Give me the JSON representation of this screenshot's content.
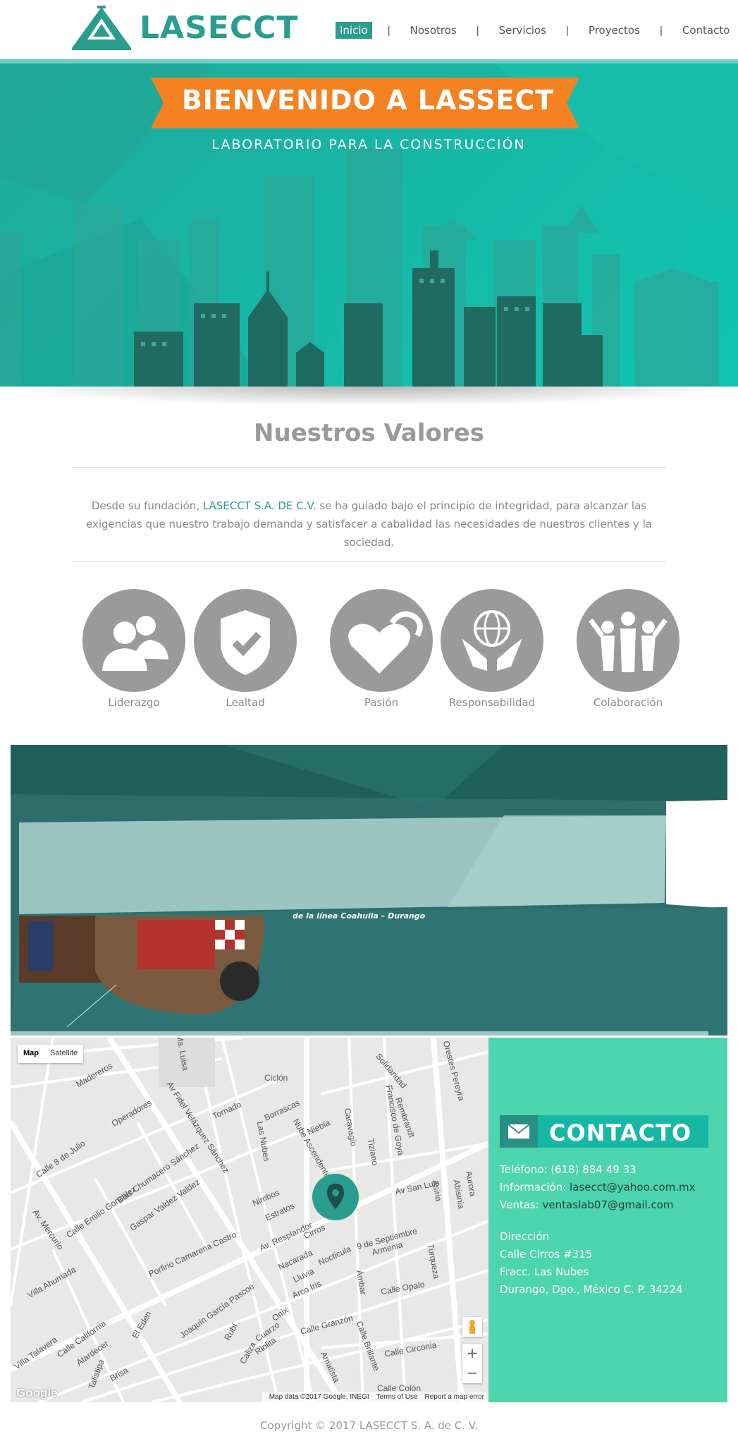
{
  "header": {
    "logo_text": "LASECCT",
    "nav": [
      {
        "label": "Inicio",
        "active": true
      },
      {
        "label": "Nosotros",
        "active": false
      },
      {
        "label": "Servicios",
        "active": false
      },
      {
        "label": "Proyectos",
        "active": false
      },
      {
        "label": "Contacto",
        "active": false
      }
    ],
    "nav_separator": "|"
  },
  "hero": {
    "title": "BIENVENIDO A LASSECT",
    "subtitle": "LABORATORIO PARA LA CONSTRUCCIÓN"
  },
  "values": {
    "title": "Nuestros Valores",
    "text_before": "Desde su fundación, ",
    "brand": "LASECCT S.A. DE C.V.",
    "text_after": " se ha guiado bajo el principio de integridad, para alcanzar las exigencias que nuestro trabajo demanda y satisfacer a cabalidad las necesidades de nuestros clientes y la sociedad.",
    "items": [
      {
        "label": "Liderazgo",
        "icon": "people-icon"
      },
      {
        "label": "Lealtad",
        "icon": "shield-check-icon"
      },
      {
        "label": "Pasión",
        "icon": "hearts-icon"
      },
      {
        "label": "Responsabilidad",
        "icon": "globe-hands-icon"
      },
      {
        "label": "Colaboración",
        "icon": "team-icon"
      }
    ]
  },
  "projects": {
    "caption": "de la línea Coahuila – Durango"
  },
  "map": {
    "toggle_map": "Map",
    "toggle_satellite": "Satellite",
    "zoom_in": "+",
    "zoom_out": "−",
    "google": "Google",
    "footer_data": "Map data ©2017 Google, INEGI",
    "footer_terms": "Terms of Use",
    "footer_report": "Report a map error",
    "streets": [
      "Madereros",
      "Ma. Luisa",
      "Ciclón",
      "Solidaridad",
      "Orestes Pereyra",
      "Av Fidel Velázquez Sánchez",
      "Operadores",
      "Tornado",
      "Borrascas",
      "Calle 8 de Julio",
      "Niebla",
      "Caravagio",
      "Francisco de Goya",
      "Rembrandt",
      "Tiziano",
      "Blas Chumacero Sánchez",
      "Las Nubes",
      "Nube Ascendente",
      "Calle Emilio González",
      "Gaspar Valdez Valdez",
      "Nimbos",
      "Estratos",
      "Av San Luis",
      "Asiria",
      "Abisinia",
      "Aurora",
      "Av. Mercurio",
      "Porfirio Camarena Castro",
      "Av. Resplandor",
      "Cirros",
      "9 de Septiembre",
      "Armenia",
      "Nacarada",
      "Nocticula",
      "Turqueza",
      "Villa Ahumada",
      "Lluvia",
      "Arco Iris",
      "Ámbar",
      "Calle Opalo",
      "Joaquín García Pascoe",
      "El Eden",
      "Calle California",
      "Onix",
      "Cuarzo",
      "Riolita",
      "Calle Granzón",
      "Calle Brillante",
      "Calle Circonia",
      "Amatista",
      "Villa Talavera",
      "Atardecer",
      "Talistipa",
      "Brisa",
      "Calle Colón",
      "Rubí",
      "Caliza"
    ]
  },
  "contact": {
    "title": "CONTACTO",
    "phone_label": "Teléfono: ",
    "phone": "(618) 884 49 33",
    "info_label": "Información: ",
    "info": "lasecct@yahoo.com.mx",
    "sales_label": "Ventas: ",
    "sales": "ventaslab07@gmail.com",
    "address_title": "Dirección",
    "address_1": "Calle Cirros #315",
    "address_2": "Fracc. Las Nubes",
    "address_3": "Durango, Dgo., México C. P. 34224"
  },
  "footer": {
    "copyright": "Copyright © 2017 LASECCT S. A. de C. V."
  },
  "colors": {
    "brand": "#2a9d8f",
    "accent_orange": "#f58220",
    "contact_bg": "#4dd5ad",
    "value_circle": "#9a9a9a"
  }
}
